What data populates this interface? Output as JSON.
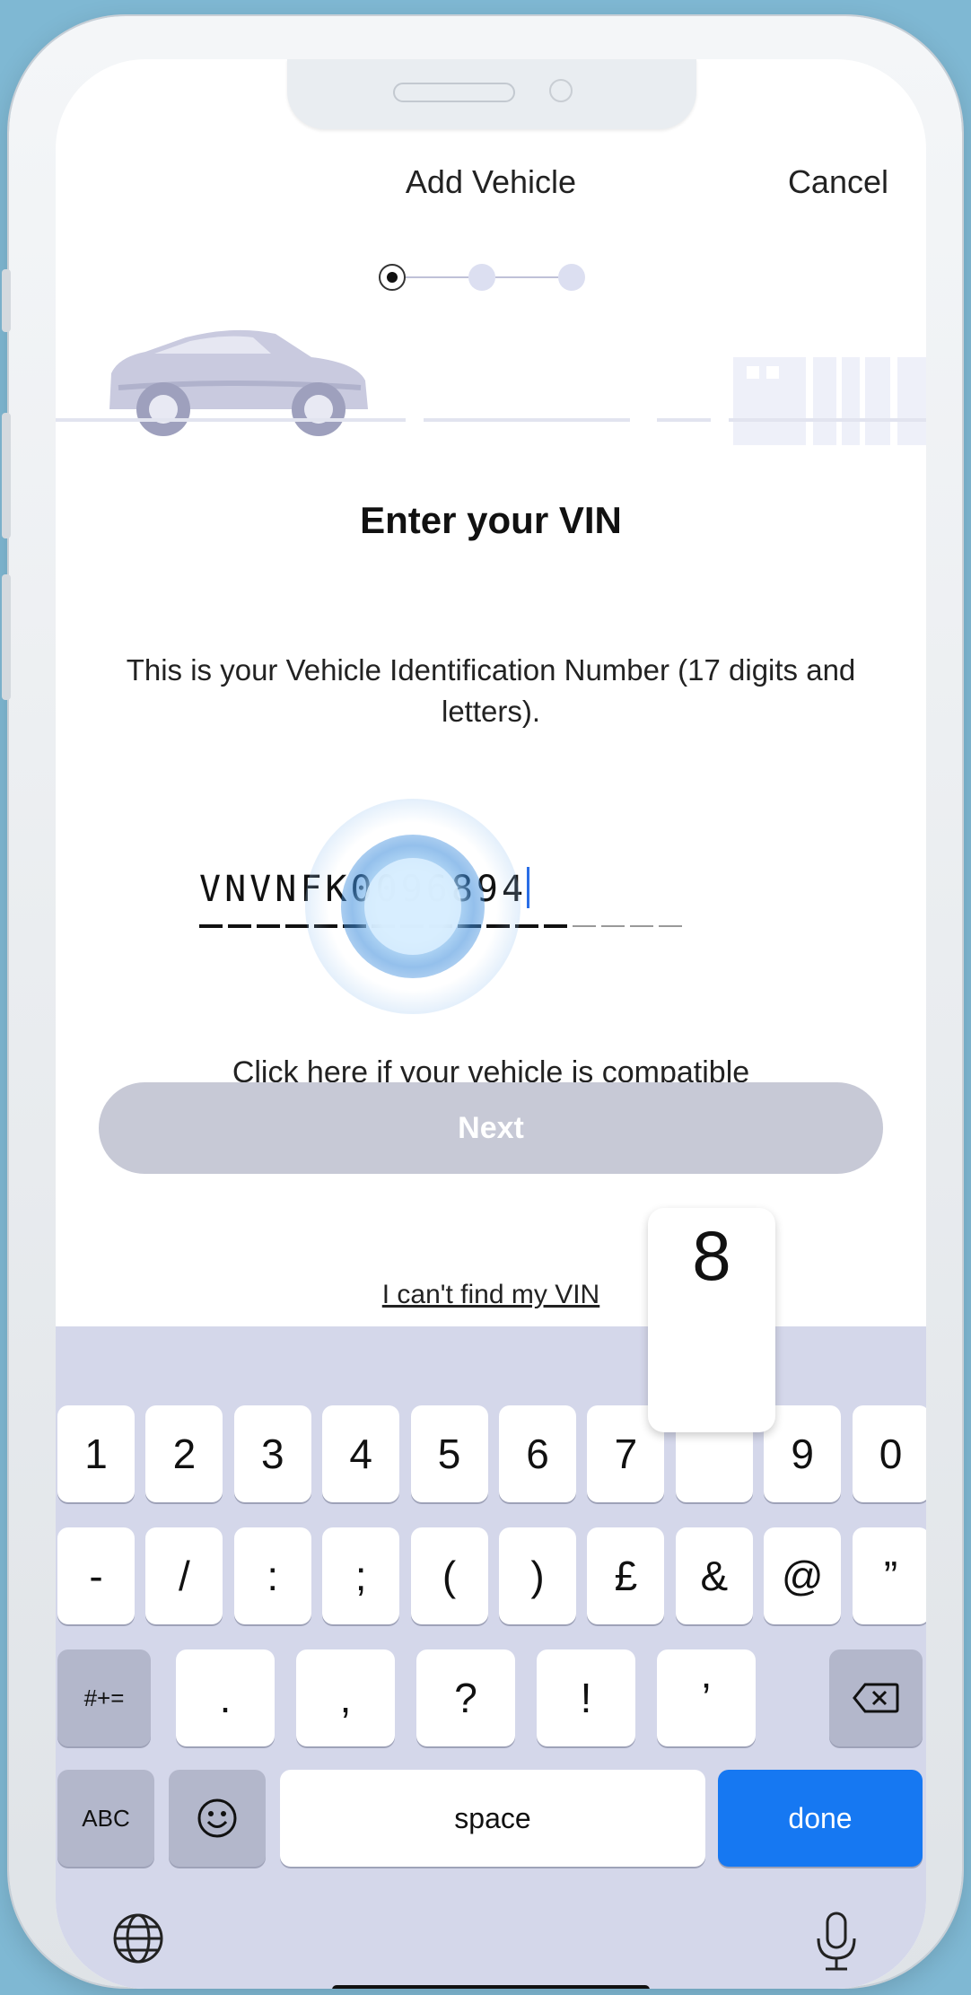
{
  "header": {
    "title": "Add Vehicle",
    "cancel_label": "Cancel"
  },
  "stepper": {
    "current_step": 1,
    "total_steps": 3
  },
  "main": {
    "heading": "Enter your VIN",
    "description": "This is your Vehicle Identification Number (17 digits and letters).",
    "vin_value": "VNVNFK0096894",
    "vin_length": 17,
    "compat_link": "Click here if your vehicle is compatible",
    "next_label": "Next",
    "cant_find_link": "I can't find my VIN"
  },
  "keyboard": {
    "popup_key": "8",
    "row1": [
      "1",
      "2",
      "3",
      "4",
      "5",
      "6",
      "7",
      "8",
      "9",
      "0"
    ],
    "row2": [
      "-",
      "/",
      ":",
      ";",
      "(",
      ")",
      "£",
      "&",
      "@",
      "”"
    ],
    "row3_left": "#+=",
    "row3": [
      ".",
      ",",
      "?",
      "!",
      "’"
    ],
    "abc_label": "ABC",
    "space_label": "space",
    "done_label": "done"
  },
  "colors": {
    "accent": "#1678f2",
    "next_disabled": "#c7c9d6",
    "keyboard_bg": "#d4d7ea",
    "illustration": "#c9cadf"
  }
}
